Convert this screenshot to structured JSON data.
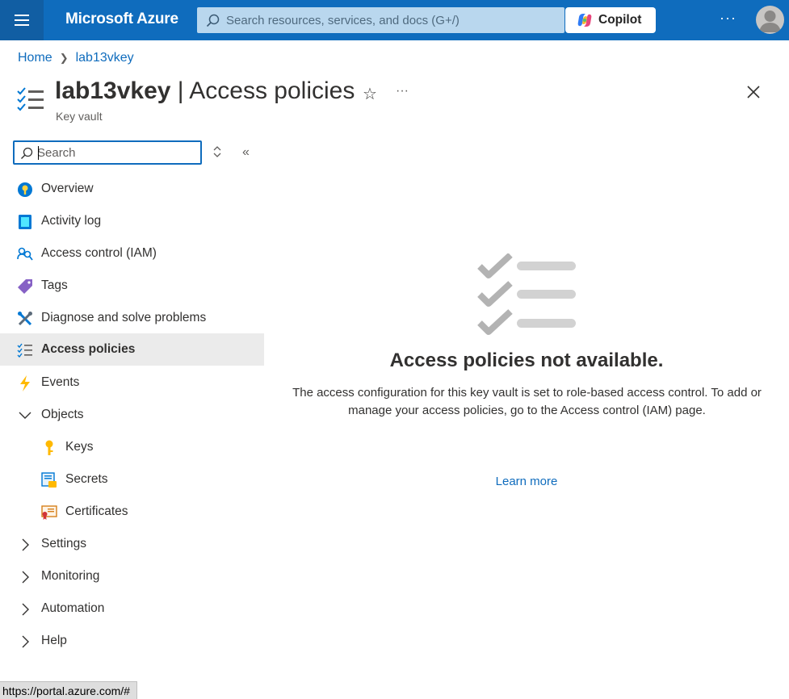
{
  "topbar": {
    "brand": "Microsoft Azure",
    "search_placeholder": "Search resources, services, and docs (G+/)",
    "copilot_label": "Copilot",
    "more": "···"
  },
  "breadcrumb": {
    "home": "Home",
    "resource": "lab13vkey"
  },
  "header": {
    "resource_name": "lab13vkey",
    "separator": " | ",
    "page_name": "Access policies",
    "subtitle": "Key vault",
    "more": "···"
  },
  "nav": {
    "search_placeholder": "Search",
    "items": [
      {
        "label": "Overview"
      },
      {
        "label": "Activity log"
      },
      {
        "label": "Access control (IAM)"
      },
      {
        "label": "Tags"
      },
      {
        "label": "Diagnose and solve problems"
      },
      {
        "label": "Access policies"
      },
      {
        "label": "Events"
      },
      {
        "label": "Objects"
      },
      {
        "label": "Keys"
      },
      {
        "label": "Secrets"
      },
      {
        "label": "Certificates"
      },
      {
        "label": "Settings"
      },
      {
        "label": "Monitoring"
      },
      {
        "label": "Automation"
      },
      {
        "label": "Help"
      }
    ]
  },
  "main": {
    "title": "Access policies not available.",
    "description": "The access configuration for this key vault is set to role-based access control. To add or manage your access policies, go to the Access control (IAM) page.",
    "learn_more": "Learn more"
  },
  "status": {
    "url": "https://portal.azure.com/#"
  },
  "colors": {
    "accent": "#0f6cbd",
    "topbar": "#0f6cbd",
    "active_nav": "#ebebeb"
  }
}
